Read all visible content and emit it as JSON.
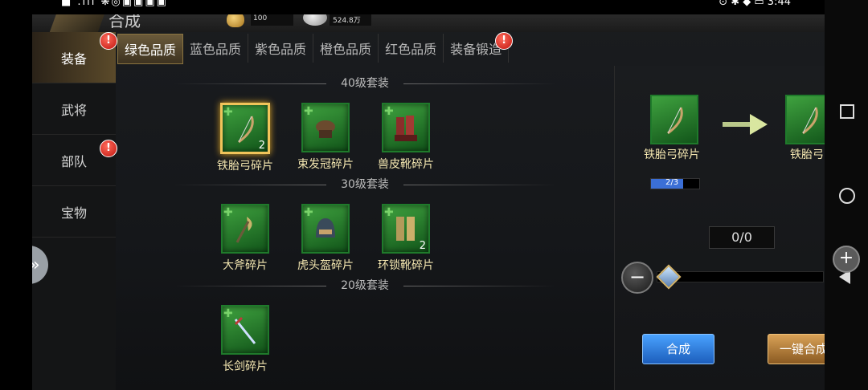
{
  "statusbar": {
    "left_icons": "■ .ııl ❋◎▣▣▣▣",
    "time": "3:44",
    "right_icons": "⊙ ✱ ◆ ▭"
  },
  "header": {
    "title": "合成",
    "gold": "100",
    "silver": "524.8万"
  },
  "sidebar": {
    "items": [
      {
        "label": "装备",
        "active": true,
        "badge": "!"
      },
      {
        "label": "武将",
        "active": false,
        "badge": ""
      },
      {
        "label": "部队",
        "active": false,
        "badge": "!"
      },
      {
        "label": "宝物",
        "active": false,
        "badge": ""
      }
    ]
  },
  "tabs": [
    {
      "label": "绿色品质",
      "active": true
    },
    {
      "label": "蓝色品质",
      "active": false
    },
    {
      "label": "紫色品质",
      "active": false
    },
    {
      "label": "橙色品质",
      "active": false
    },
    {
      "label": "红色品质",
      "active": false
    },
    {
      "label": "装备锻造",
      "active": false,
      "badge": "!"
    }
  ],
  "sections": [
    {
      "title": "40级套装",
      "items": [
        {
          "name": "铁胎弓碎片",
          "qty": "2",
          "selected": true,
          "icon": "bow-icon"
        },
        {
          "name": "束发冠碎片",
          "qty": "",
          "icon": "helmet-icon"
        },
        {
          "name": "兽皮靴碎片",
          "qty": "",
          "icon": "boots-icon"
        }
      ]
    },
    {
      "title": "30级套装",
      "items": [
        {
          "name": "大斧碎片",
          "qty": "",
          "icon": "axe-icon"
        },
        {
          "name": "虎头盔碎片",
          "qty": "",
          "icon": "tiger-helmet-icon"
        },
        {
          "name": "环锁靴碎片",
          "qty": "2",
          "icon": "chain-boots-icon"
        }
      ]
    },
    {
      "title": "20级套装",
      "items": [
        {
          "name": "长剑碎片",
          "qty": "",
          "icon": "sword-icon"
        }
      ]
    }
  ],
  "panel": {
    "source_name": "铁胎弓碎片",
    "target_name": "铁胎弓",
    "progress_text": "2/3",
    "progress_value": 0.6667,
    "quantity": "0/0",
    "slider_minus": "−",
    "slider_plus": "+",
    "synth_button": "合成",
    "synth_all_button": "一键合成"
  },
  "colors": {
    "tile_green": "#2e8b36",
    "selected_gold": "#f1c45a",
    "badge_red": "#d8221b",
    "text_gold": "#f3e6b0"
  }
}
